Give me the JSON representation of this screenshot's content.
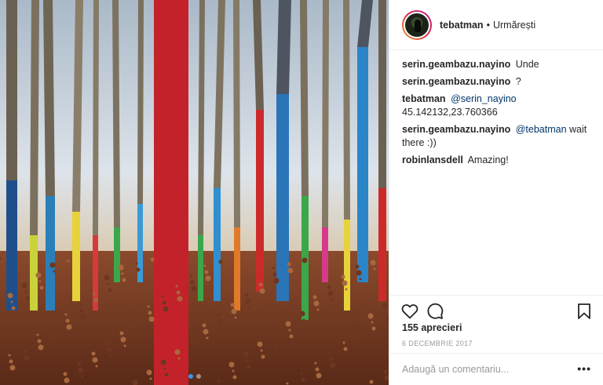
{
  "post": {
    "author": {
      "username": "tebatman",
      "separator": "•",
      "follow_label": "Urmărești"
    },
    "comments": [
      {
        "user": "serin.geambazu.nayino",
        "mention": "",
        "text": "Unde"
      },
      {
        "user": "serin.geambazu.nayino",
        "mention": "",
        "text": "?"
      },
      {
        "user": "tebatman",
        "mention": "@serin_nayino",
        "text": "45.142132,23.760366"
      },
      {
        "user": "serin.geambazu.nayino",
        "mention": "@tebatman",
        "text": "wait there :))"
      },
      {
        "user": "robinlansdell",
        "mention": "",
        "text": "Amazing!"
      }
    ],
    "likes": "155 aprecieri",
    "date": "6 DECEMBRIE 2017",
    "add_comment_placeholder": "Adaugă un comentariu...",
    "more_label": "•••",
    "icons": [
      "heart-icon",
      "comment-icon",
      "bookmark-icon",
      "avatar"
    ],
    "carousel": {
      "count": 2,
      "active": 1
    },
    "colors": {
      "mention": "#003569",
      "active_dot": "#3897f0",
      "muted": "#999999"
    }
  }
}
